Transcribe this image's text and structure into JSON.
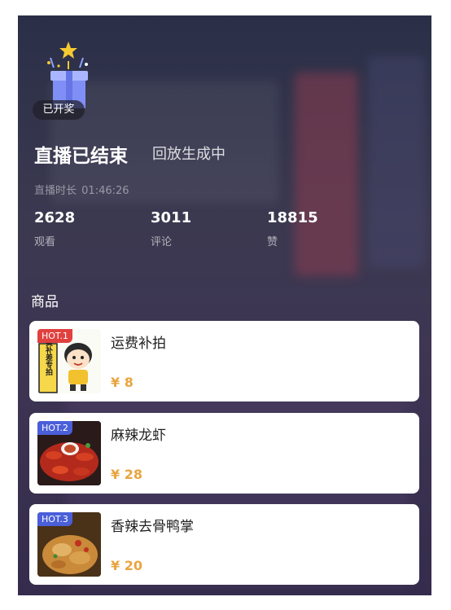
{
  "gift_badge": "已开奖",
  "title": "直播已结束",
  "subtitle": "回放生成中",
  "duration": {
    "label": "直播时长",
    "value": "01:46:26"
  },
  "stats": [
    {
      "value": "2628",
      "label": "观看"
    },
    {
      "value": "3011",
      "label": "评论"
    },
    {
      "value": "18815",
      "label": "赞"
    }
  ],
  "section_title": "商品",
  "products": [
    {
      "hot": "HOT.1",
      "hot_color": "#e0413f",
      "name": "运费补拍",
      "price": "¥ 8",
      "thumb_text": "邮费补差专拍"
    },
    {
      "hot": "HOT.2",
      "hot_color": "#4a5fd8",
      "name": "麻辣龙虾",
      "price": "¥ 28"
    },
    {
      "hot": "HOT.3",
      "hot_color": "#4a5fd8",
      "name": "香辣去骨鸭掌",
      "price": "¥ 20"
    }
  ],
  "colors": {
    "price": "#e9a540",
    "background": "#3b3950"
  }
}
